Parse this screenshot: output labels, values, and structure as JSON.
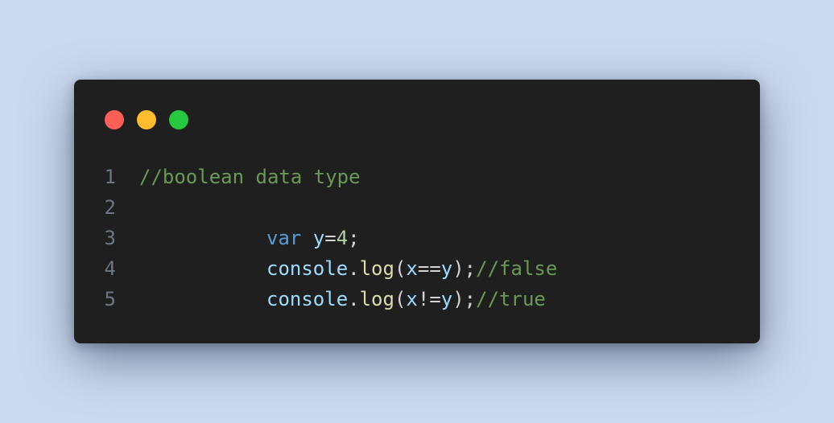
{
  "window_controls": {
    "close_color": "#ff5f57",
    "minimize_color": "#febc2e",
    "maximize_color": "#28c840"
  },
  "code": {
    "lines": [
      {
        "number": "1",
        "comment": "//boolean data type"
      },
      {
        "number": "2"
      },
      {
        "number": "3",
        "keyword": "var",
        "variable": "y",
        "operator": "=",
        "value": "4",
        "end": ";"
      },
      {
        "number": "4",
        "object": "console",
        "dot": ".",
        "method": "log",
        "open": "(",
        "arg_left": "x",
        "operator": "==",
        "arg_right": "y",
        "close": ");",
        "comment": "//false"
      },
      {
        "number": "5",
        "object": "console",
        "dot": ".",
        "method": "log",
        "open": "(",
        "arg_left": "x",
        "operator": "!=",
        "arg_right": "y",
        "close": ");",
        "comment": "//true"
      }
    ]
  }
}
